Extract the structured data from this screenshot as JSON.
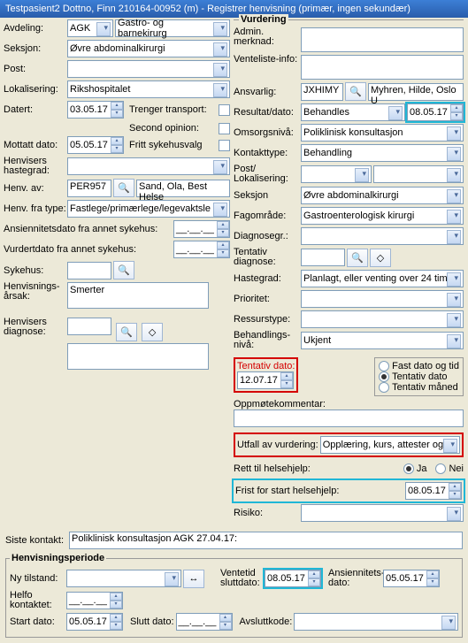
{
  "title": "Testpasient2 Dottno, Finn  210164-00952 (m) - Registrer henvisning (primær, ingen sekundær)",
  "left": {
    "avdeling_lbl": "Avdeling:",
    "avdeling": "AGK",
    "avdeling2": "Gastro- og barnekirurg",
    "seksjon_lbl": "Seksjon:",
    "seksjon": "Øvre abdominalkirurgi",
    "post_lbl": "Post:",
    "post": "",
    "lokalisering_lbl": "Lokalisering:",
    "lokalisering": "Rikshospitalet",
    "datert_lbl": "Datert:",
    "datert": "03.05.17",
    "trenger_transport": "Trenger transport:",
    "second_opinion": "Second opinion:",
    "mottatt_lbl": "Mottatt dato:",
    "mottatt": "05.05.17",
    "fritt": "Fritt sykehusvalg",
    "hastegrad_lbl": "Henvisers hastegrad:",
    "henv_av_lbl": "Henv. av:",
    "henv_av": "PER957",
    "henv_av_name": "Sand, Ola, Best Helse",
    "henv_fra_type_lbl": "Henv. fra type:",
    "henv_fra_type": "Fastlege/primærlege/legevaktsle",
    "ansiennitet_lbl": "Ansiennitetsdato fra annet sykehus:",
    "ansiennitet_val": "__.__.__",
    "vurdert_lbl": "Vurdertdato fra annet sykehus:",
    "vurdert_val": "__.__.__",
    "sykehus_lbl": "Sykehus:",
    "arsak_lbl": "Henvisnings-årsak:",
    "arsak": "Smerter",
    "diag_lbl": "Henvisers diagnose:"
  },
  "right": {
    "legend": "Vurdering",
    "admin_lbl": "Admin.\nmerknad:",
    "venteliste_lbl": "Venteliste-info:",
    "ansvarlig_lbl": "Ansvarlig:",
    "ansvarlig": "JXHIMY",
    "ansvarlig_name": "Myhren, Hilde, Oslo U",
    "resultat_lbl": "Resultat/dato:",
    "resultat": "Behandles",
    "resultat_dato": "08.05.17",
    "omsorg_lbl": "Omsorgsnivå:",
    "omsorg": "Poliklinisk konsultasjon",
    "kontakttype_lbl": "Kontakttype:",
    "kontakttype": "Behandling",
    "post_lok_lbl": "Post/\nLokalisering:",
    "seksjon_lbl": "Seksjon",
    "seksjon": "Øvre abdominalkirurgi",
    "fagomrade_lbl": "Fagområde:",
    "fagomrade": "Gastroenterologisk kirurgi",
    "diagnosegr_lbl": "Diagnosegr.:",
    "tentativ_diag_lbl": "Tentativ diagnose:",
    "hastegrad_lbl": "Hastegrad:",
    "hastegrad": "Planlagt, eller venting over 24 tim",
    "prioritet_lbl": "Prioritet:",
    "ressurstype_lbl": "Ressurstype:",
    "behandling_lbl": "Behandlings-nivå:",
    "behandling": "Ukjent",
    "tentativ_dato_lbl": "Tentativ dato:",
    "tentativ_dato": "12.07.17",
    "radio_fast": "Fast dato og tid",
    "radio_tentativ": "Tentativ dato",
    "radio_maned": "Tentativ måned",
    "oppmote_lbl": "Oppmøtekommentar:",
    "utfall_lbl": "Utfall av vurdering:",
    "utfall": "Opplæring, kurs, attester og ",
    "rett_lbl": "Rett til helsehjelp:",
    "ja": "Ja",
    "nei": "Nei",
    "frist_lbl": "Frist for start helsehjelp:",
    "frist": "08.05.17",
    "risiko_lbl": "Risiko:"
  },
  "siste_lbl": "Siste kontakt:",
  "siste": "Poliklinisk konsultasjon AGK 27.04.17:",
  "hp": {
    "legend": "Henvisningsperiode",
    "ny_tilstand_lbl": "Ny tilstand:",
    "ventetid_lbl": "Ventetid sluttdato:",
    "ventetid": "08.05.17",
    "ans_lbl": "Ansiennitets-dato:",
    "ans": "05.05.17",
    "helfo_lbl": "Helfo kontaktet:",
    "helfo": "__.__.__",
    "start_lbl": "Start dato:",
    "start": "05.05.17",
    "slutt_lbl": "Slutt dato:",
    "slutt": "__.__.__",
    "avslutt_lbl": "Avsluttkode:"
  }
}
